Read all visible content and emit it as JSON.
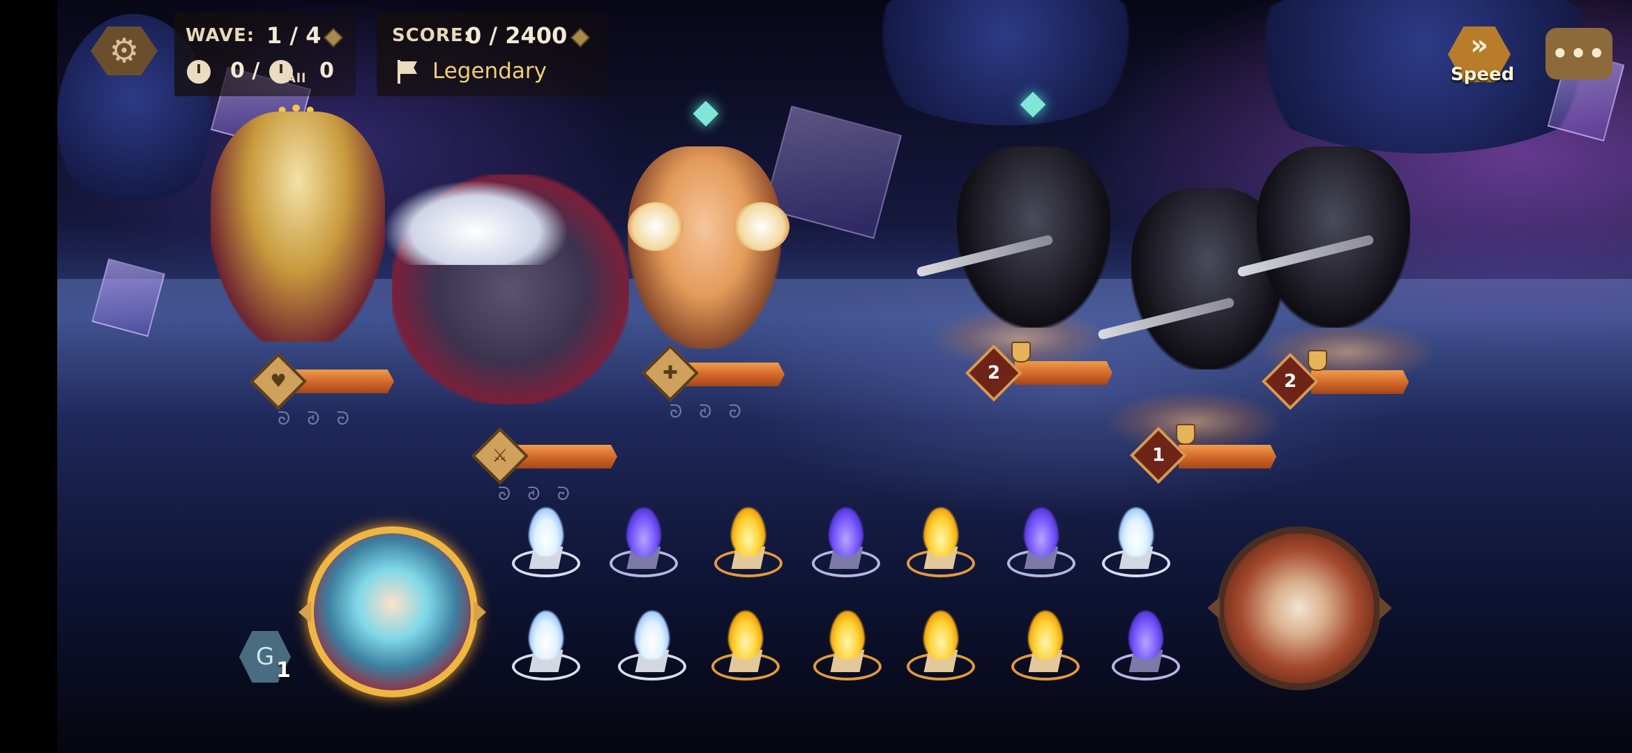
{
  "hud": {
    "wave_label": "WAVE:",
    "wave_value": "1 / 4",
    "score_label": "SCORE:",
    "score_value": "0 / 2400",
    "turns_value": "0 /",
    "all_label": "All",
    "all_turns_value": "0",
    "difficulty": "Legendary",
    "speed_label": "Speed",
    "chat_icon_text": "•••"
  },
  "icons": {
    "settings": "gear-icon",
    "clock": "clock-icon",
    "flag": "flag-icon",
    "speed": "fast-forward-icon",
    "chat": "chat-bubble-icon"
  },
  "allies": [
    {
      "name": "sage",
      "badge_glyph": "♥",
      "runes": "ᘐᘑᘒ"
    },
    {
      "name": "beast",
      "badge_glyph": "⚔",
      "runes": "ᘐᘑᘒ"
    },
    {
      "name": "cheerleader",
      "badge_glyph": "✚",
      "runes": "ᘐᘑᘒ"
    }
  ],
  "enemies": [
    {
      "name": "knight-left",
      "badge_value": "2"
    },
    {
      "name": "knight-center",
      "badge_value": "1"
    },
    {
      "name": "knight-right",
      "badge_value": "2"
    }
  ],
  "orbs": {
    "row1": [
      "white",
      "purple",
      "gold",
      "purple",
      "gold",
      "purple",
      "white"
    ],
    "row2": [
      "white",
      "white",
      "gold",
      "gold",
      "gold",
      "gold",
      "purple"
    ]
  },
  "player": {
    "skill_count": "1",
    "skill_icon_text": "G"
  },
  "colors": {
    "accent_gold": "#f0b642",
    "hp_orange": "#d0652a",
    "legendary_text": "#f1cf73",
    "enemy_badge": "#6e2416"
  }
}
